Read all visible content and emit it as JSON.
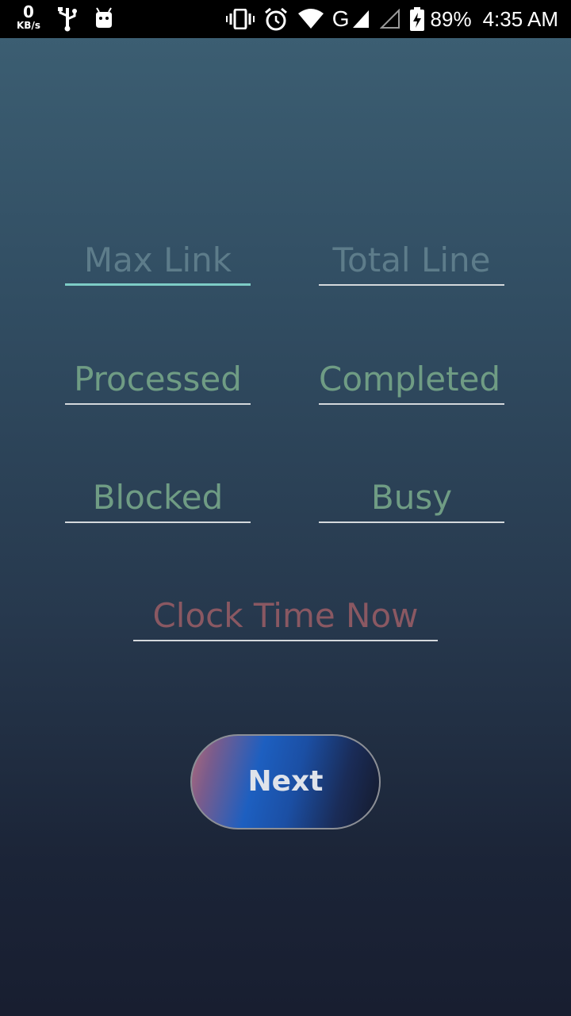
{
  "status_bar": {
    "net_speed_value": "0",
    "net_speed_unit": "KB/s",
    "network_type": "G",
    "battery_percent": "89%",
    "time": "4:35 AM",
    "icons": [
      "usb-icon",
      "android-debug-icon",
      "vibrate-icon",
      "alarm-icon",
      "wifi-icon",
      "signal-icon",
      "signal-empty-icon",
      "battery-charging-icon"
    ]
  },
  "form": {
    "max_link_placeholder": "Max Link",
    "total_line_placeholder": "Total Line",
    "processed": "Processed",
    "completed": "Completed",
    "blocked": "Blocked",
    "busy": "Busy",
    "clock_time": "Clock Time Now"
  },
  "actions": {
    "next_label": "Next"
  },
  "colors": {
    "background_top": "#3d6074",
    "background_bottom": "#181e30",
    "focus_underline": "#7dccc6",
    "placeholder": "#5d7c8a",
    "value_green": "#6f9c84",
    "value_red": "#8a5862"
  }
}
